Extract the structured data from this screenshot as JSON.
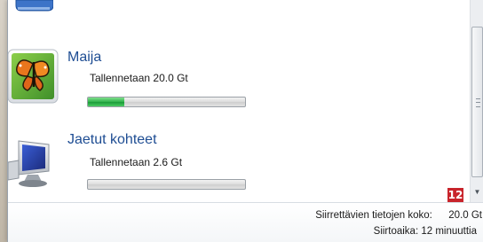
{
  "items": [
    {
      "name": "Maija",
      "status": "Tallennetaan 20.0 Gt",
      "progress": 0.23,
      "icon": "butterfly-user-icon"
    },
    {
      "name": "Jaetut kohteet",
      "status": "Tallennetaan 2.6 Gt",
      "progress": 0,
      "icon": "computer-monitor-icon"
    }
  ],
  "summary": {
    "size_label": "Siirrettävien tietojen koko:",
    "size_value": "20.0 Gt",
    "time_label": "Siirtoaika: 12 minuuttia"
  },
  "badge": "12",
  "colors": {
    "accent_blue": "#1e4d93",
    "progress_green": "#2fb14a",
    "badge_red": "#c8242b"
  }
}
